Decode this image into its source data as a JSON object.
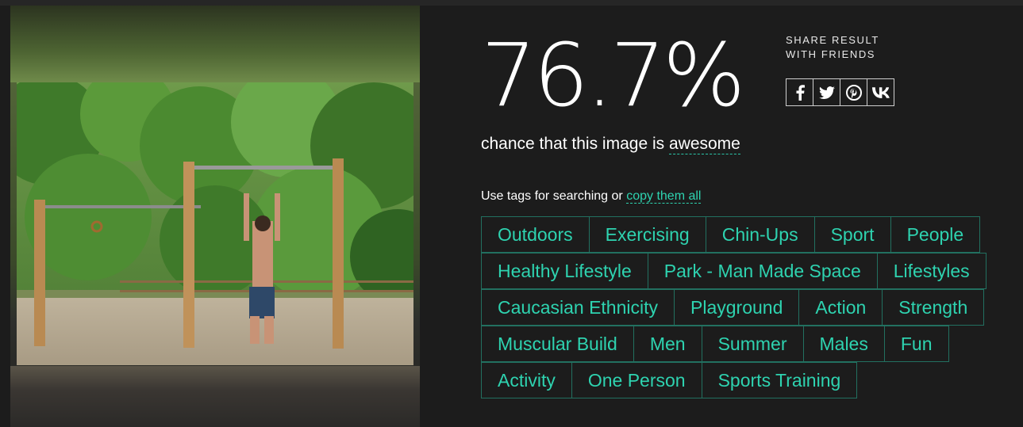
{
  "result": {
    "score": "76.7%",
    "chance_prefix": "chance that this image is ",
    "chance_word": "awesome"
  },
  "share": {
    "title": "SHARE RESULT WITH FRIENDS",
    "buttons": [
      {
        "icon": "facebook-icon",
        "glyph": "f"
      },
      {
        "icon": "twitter-icon",
        "glyph": "t"
      },
      {
        "icon": "pinterest-icon",
        "glyph": "p"
      },
      {
        "icon": "vk-icon",
        "glyph": "vk"
      }
    ]
  },
  "tags_intro": {
    "text": "Use tags for searching or ",
    "link": "copy them all"
  },
  "tags": [
    [
      "Outdoors",
      "Exercising",
      "Chin-Ups",
      "Sport",
      "People"
    ],
    [
      "Healthy Lifestyle",
      "Park - Man Made Space",
      "Lifestyles"
    ],
    [
      "Caucasian Ethnicity",
      "Playground",
      "Action",
      "Strength"
    ],
    [
      "Muscular Build",
      "Men",
      "Summer",
      "Males",
      "Fun"
    ],
    [
      "Activity",
      "One Person",
      "Sports Training"
    ]
  ],
  "colors": {
    "background": "#1c1c1c",
    "accent": "#2ed3b0",
    "tag_border": "#227060"
  }
}
